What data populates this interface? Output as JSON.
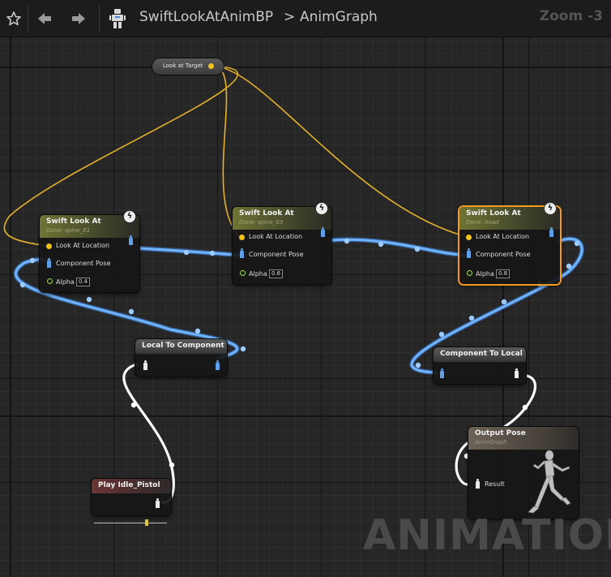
{
  "toolbar": {
    "breadcrumb_blueprint": "SwiftLookAtAnimBP",
    "breadcrumb_separator": ">",
    "breadcrumb_graph": "AnimGraph",
    "zoom": "Zoom -3"
  },
  "variable_node": {
    "label": "Look at Target"
  },
  "nodes": {
    "swift1": {
      "title": "Swift Look At",
      "subtitle": "Done: spine_01",
      "pin_location": "Look At Location",
      "pin_pose": "Component Pose",
      "alpha_label": "Alpha",
      "alpha_value": "0.4"
    },
    "swift2": {
      "title": "Swift Look At",
      "subtitle": "Done: spine_03",
      "pin_location": "Look At Location",
      "pin_pose": "Component Pose",
      "alpha_label": "Alpha",
      "alpha_value": "0.6"
    },
    "swift3": {
      "title": "Swift Look At",
      "subtitle": "Done: head",
      "pin_location": "Look At Location",
      "pin_pose": "Component Pose",
      "alpha_label": "Alpha",
      "alpha_value": "0.8"
    },
    "local_to_component": {
      "title": "Local To Component"
    },
    "component_to_local": {
      "title": "Component To Local"
    },
    "play_idle": {
      "title": "Play Idle_Pistol",
      "playback_position": 0.72
    },
    "output_pose": {
      "title": "Output Pose",
      "subtitle": "AnimGraph",
      "pin_result": "Result"
    }
  },
  "watermark": "ANIMATION",
  "colors": {
    "selection_outline": "#f29b1e",
    "pose_wire": "#5da2f0",
    "local_pose_wire": "#ffffff",
    "vector_wire": "#e4b12a",
    "alpha_pin": "#9be24c"
  },
  "icons": [
    "star-icon",
    "back-arrow-icon",
    "forward-arrow-icon",
    "blueprint-icon",
    "lightning-icon",
    "pose-pin-icon",
    "mannequin-preview-icon"
  ]
}
